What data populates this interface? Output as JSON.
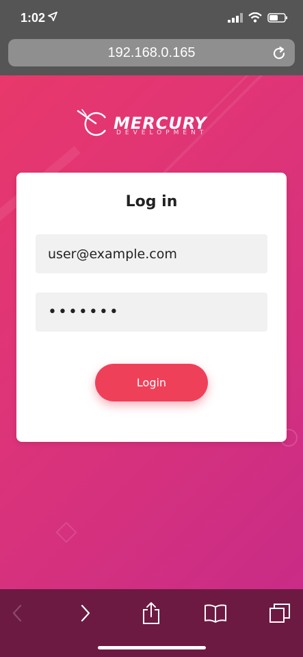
{
  "status_bar": {
    "time": "1:02"
  },
  "browser": {
    "url": "192.168.0.165"
  },
  "brand": {
    "name": "MERCURY",
    "subtitle": "DEVELOPMENT"
  },
  "login": {
    "title": "Log in",
    "email_value": "user@example.com",
    "password_value": "•••••••",
    "button_label": "Login"
  },
  "colors": {
    "accent": "#ee4159",
    "background_start": "#e8386b",
    "background_end": "#c92c86",
    "toolbar": "#6c1a42"
  },
  "toolbar": {
    "icons": [
      "back-icon",
      "forward-icon",
      "share-icon",
      "bookmarks-icon",
      "tabs-icon"
    ]
  }
}
